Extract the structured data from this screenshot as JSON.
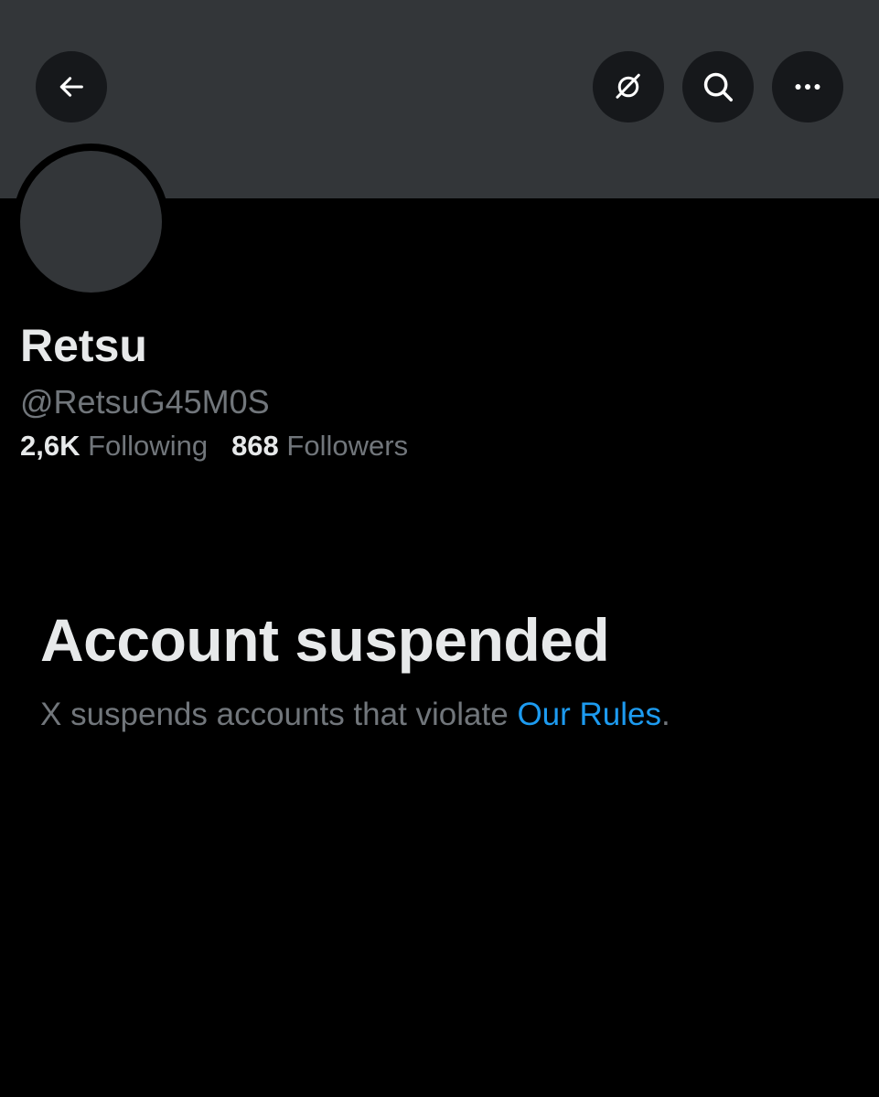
{
  "header": {
    "back_icon": "arrow-left-icon",
    "grok_icon": "grok-icon",
    "search_icon": "search-icon",
    "more_icon": "more-horizontal-icon"
  },
  "profile": {
    "display_name": "Retsu",
    "handle": "@RetsuG45M0S",
    "following_count": "2,6K",
    "following_label": "Following",
    "followers_count": "868",
    "followers_label": "Followers"
  },
  "suspension": {
    "title": "Account suspended",
    "message_prefix": "X suspends accounts that violate ",
    "rules_link": "Our Rules",
    "message_suffix": "."
  },
  "colors": {
    "background": "#000000",
    "banner": "#333639",
    "button_bg": "#16181b",
    "primary_text": "#e7e9ea",
    "secondary_text": "#71767b",
    "link": "#1d9bf0"
  }
}
